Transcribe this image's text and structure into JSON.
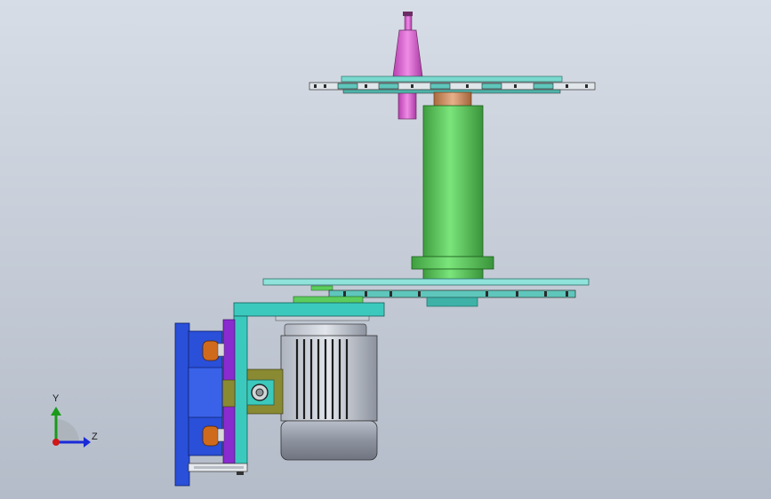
{
  "viewport": {
    "background_top": "#d7dde6",
    "background_bottom": "#b4bcc9"
  },
  "triad": {
    "y_label": "Y",
    "z_label": "Z",
    "y_color": "#1a9a1a",
    "z_color": "#1a2ad8",
    "origin_color": "#d01818"
  },
  "colors": {
    "tool_holder": "#d060c8",
    "spindle_column": "#5ccd5c",
    "bronze_bushing": "#c8895a",
    "plate_cyan": "#79d9cf",
    "bracket_teal": "#3cc9bd",
    "base_blue": "#2a4fd8",
    "purple_plate": "#8a2bd0",
    "bearing_orange": "#cf6a1d",
    "motor_gray": "#9ba1ad",
    "coupling_olive": "#8a8a32"
  }
}
